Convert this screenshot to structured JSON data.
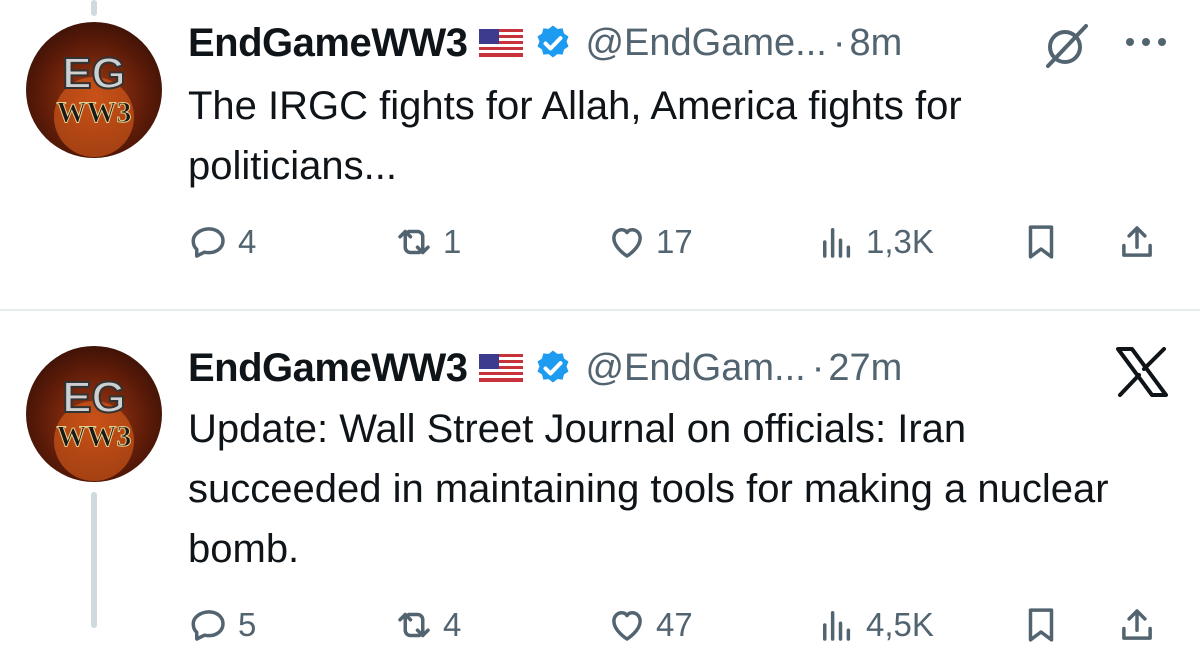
{
  "tweets": [
    {
      "display_name": "EndGameWW3",
      "handle": "@EndGame...",
      "dot": "·",
      "time": "8m",
      "avatar_text": "EG WW3",
      "text": "The IRGC fights for Allah, America fights for politicians...",
      "replies": "4",
      "reposts": "1",
      "likes": "17",
      "views": "1,3K",
      "top_icon": "grok-icon"
    },
    {
      "display_name": "EndGameWW3",
      "handle": "@EndGam...",
      "dot": "·",
      "time": "27m",
      "avatar_text": "EG WW3",
      "text": "Update: Wall Street Journal on officials: Iran succeeded in maintaining tools for making a nuclear bomb.",
      "replies": "5",
      "reposts": "4",
      "likes": "47",
      "views": "4,5K",
      "top_icon": "x-logo-icon"
    }
  ],
  "colors": {
    "text": "#0f1419",
    "secondary": "#536471",
    "verified": "#1d9bf0",
    "thread_line": "#cfd9de",
    "divider": "#e7ecef"
  }
}
